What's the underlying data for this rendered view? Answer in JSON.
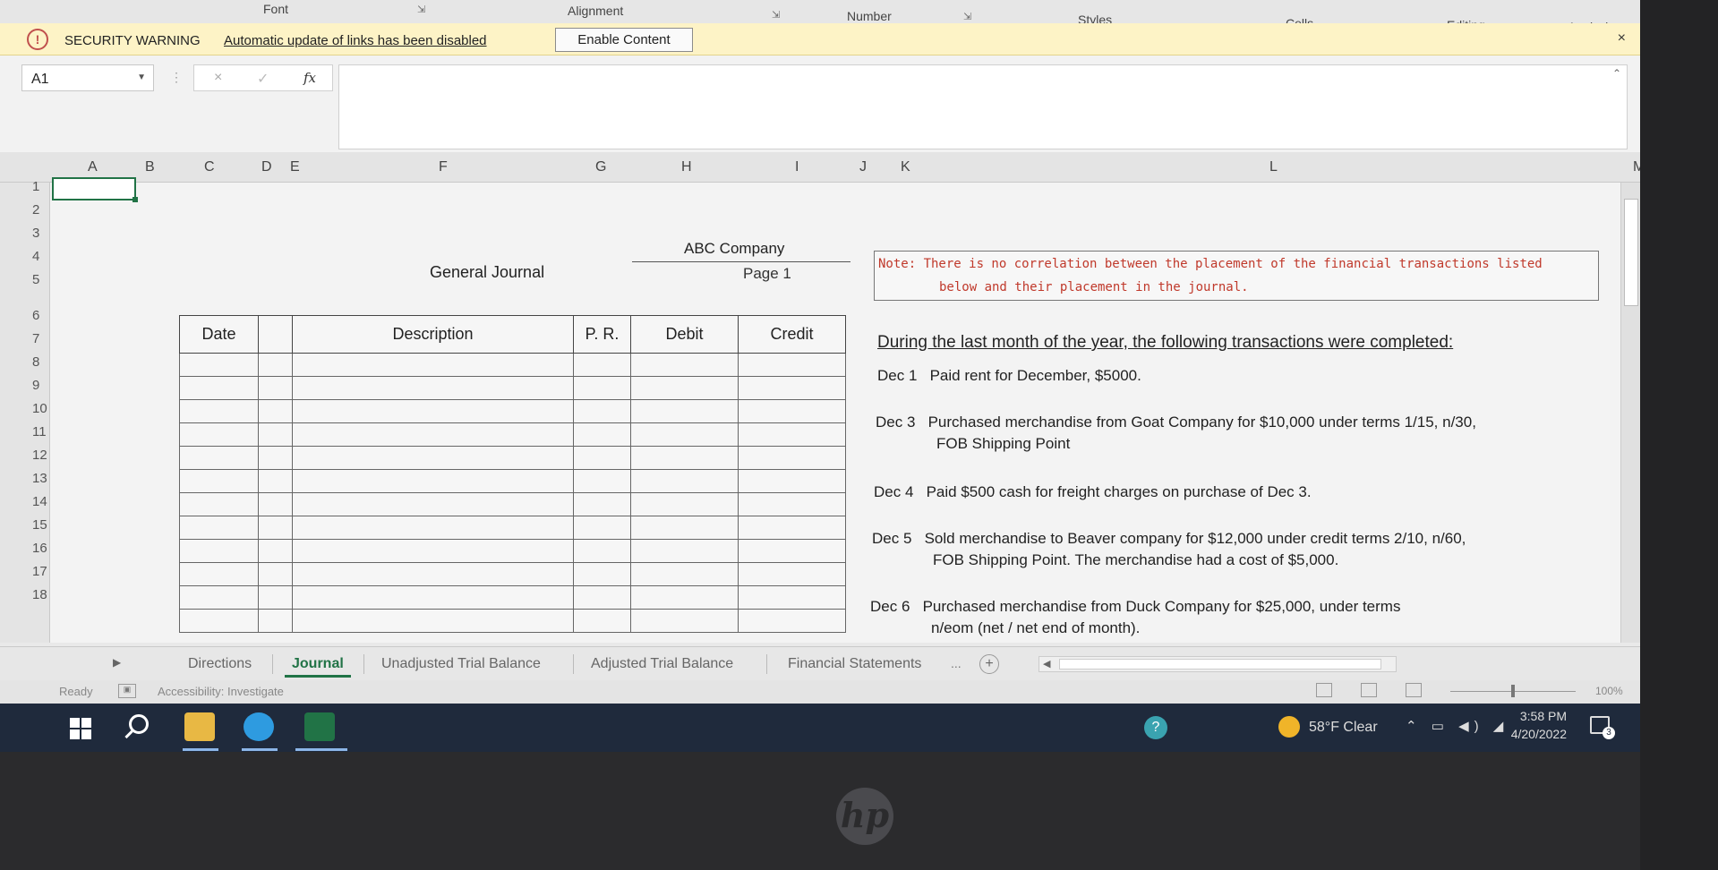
{
  "ribbon": {
    "groups": [
      "Font",
      "Alignment",
      "Number",
      "Styles",
      "Cells",
      "Editing",
      "Analysis"
    ]
  },
  "security_bar": {
    "title": "SECURITY WARNING",
    "message": "Automatic update of links has been disabled",
    "button": "Enable Content",
    "close": "×"
  },
  "formula_bar": {
    "name_box": "A1",
    "cancel": "×",
    "enter": "✓",
    "fx": "fx",
    "value": ""
  },
  "columns": [
    "A",
    "B",
    "C",
    "D",
    "E",
    "F",
    "G",
    "H",
    "I",
    "J",
    "K",
    "L",
    "M"
  ],
  "rows": [
    "1",
    "2",
    "3",
    "4",
    "5",
    "6",
    "7",
    "8",
    "9",
    "10",
    "11",
    "12",
    "13",
    "14",
    "15",
    "16",
    "17",
    "18"
  ],
  "sheet": {
    "journal_title": "General Journal",
    "company": "ABC Company",
    "page": "Page 1",
    "table_headers": [
      "Date",
      "Description",
      "P. R.",
      "Debit",
      "Credit"
    ],
    "note_line1": "Note:  There is no correlation between the placement of the financial transactions listed",
    "note_line2": "below and their placement in the journal.",
    "transactions_title": "During the last month of the year, the following transactions were completed:",
    "transactions": [
      {
        "date": "Dec 1",
        "text": "Paid rent for December, $5000.",
        "cont": ""
      },
      {
        "date": "Dec 3",
        "text": "Purchased merchandise from Goat Company for $10,000 under terms 1/15, n/30,",
        "cont": "FOB Shipping  Point"
      },
      {
        "date": "Dec 4",
        "text": "Paid $500 cash for freight charges on purchase of Dec 3.",
        "cont": ""
      },
      {
        "date": "Dec 5",
        "text": "Sold merchandise to Beaver company for $12,000 under credit terms 2/10, n/60,",
        "cont": "FOB Shipping Point.  The merchandise had a cost of $5,000."
      },
      {
        "date": "Dec 6",
        "text": "Purchased merchandise from Duck Company for $25,000, under terms",
        "cont": "n/eom (net / net end of month)."
      }
    ]
  },
  "tabs": [
    "Directions",
    "Journal",
    "Unadjusted Trial Balance",
    "Adjusted Trial Balance",
    "Financial Statements"
  ],
  "active_tab": "Journal",
  "tabs_more": "...",
  "tabs_add": "+",
  "status": {
    "ready": "Ready",
    "accessibility": "Accessibility: Investigate",
    "zoom": "100%"
  },
  "taskbar": {
    "weather": "58°F  Clear",
    "time": "3:58 PM",
    "date": "4/20/2022",
    "notifications": "3",
    "help": "?"
  },
  "logo": "hp",
  "colors": {
    "excel_green": "#217346",
    "warning_bar": "#fdf3c6",
    "note_red": "#c0392b",
    "taskbar": "#1f2a3c"
  }
}
